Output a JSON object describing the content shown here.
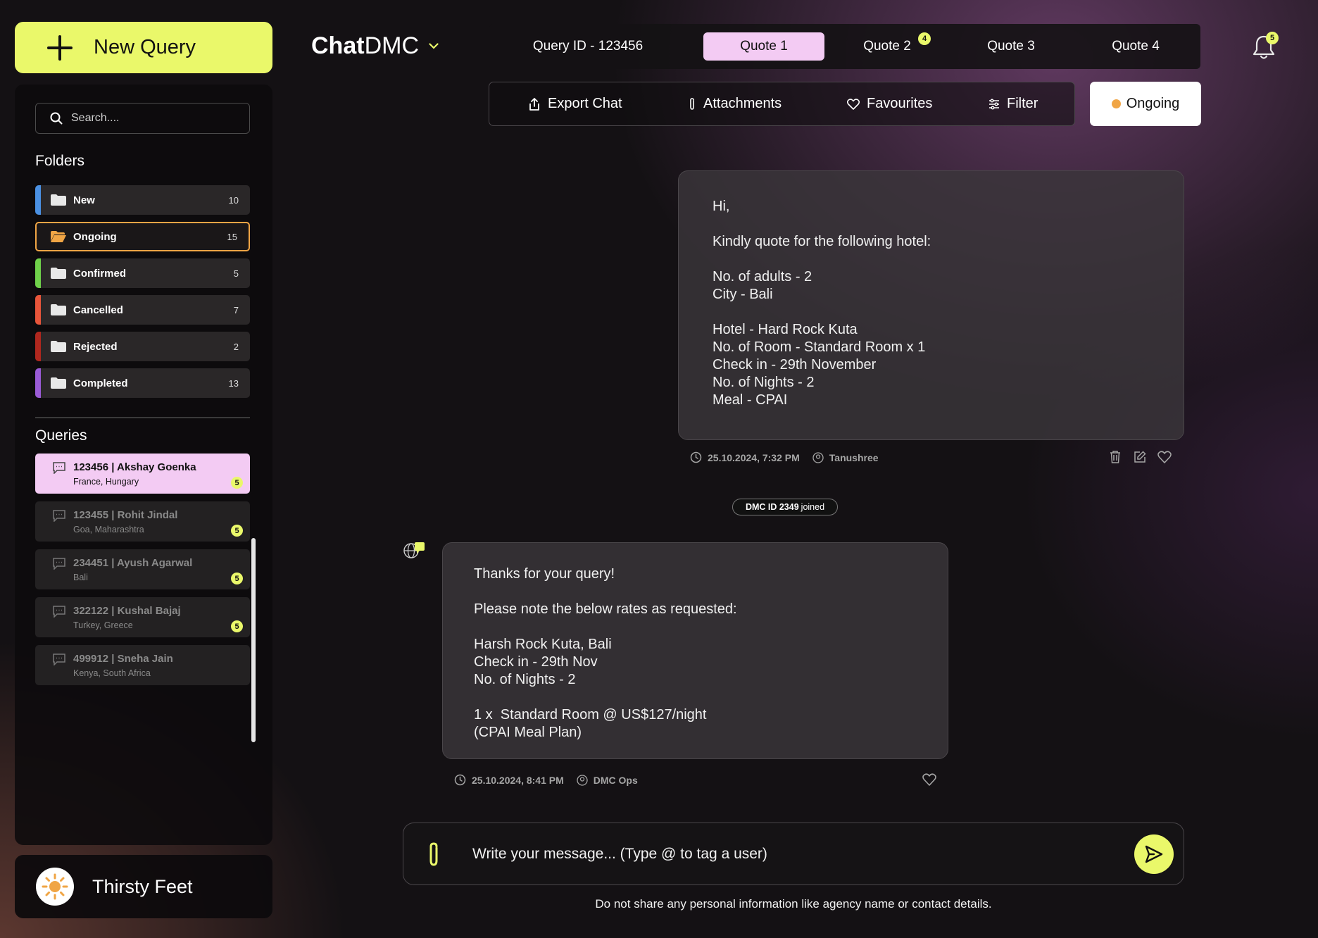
{
  "new_query": {
    "label": "New Query"
  },
  "sidebar": {
    "search_placeholder": "Search....",
    "folders_title": "Folders",
    "folders": [
      {
        "label": "New",
        "count": "10",
        "color": "#4a90e2"
      },
      {
        "label": "Ongoing",
        "count": "15",
        "color": "#f0a545"
      },
      {
        "label": "Confirmed",
        "count": "5",
        "color": "#6fd14a"
      },
      {
        "label": "Cancelled",
        "count": "7",
        "color": "#e8553a"
      },
      {
        "label": "Rejected",
        "count": "2",
        "color": "#b0271e"
      },
      {
        "label": "Completed",
        "count": "13",
        "color": "#9a5bd6"
      }
    ],
    "queries_title": "Queries",
    "queries": [
      {
        "title": "123456 | Akshay Goenka",
        "sub": "France, Hungary",
        "badge": "5"
      },
      {
        "title": "123455 | Rohit Jindal",
        "sub": "Goa, Maharashtra",
        "badge": "5"
      },
      {
        "title": "234451 | Ayush Agarwal",
        "sub": "Bali",
        "badge": "5"
      },
      {
        "title": "322122 | Kushal Bajaj",
        "sub": "Turkey, Greece",
        "badge": "5"
      },
      {
        "title": "499912 | Sneha Jain",
        "sub": "Kenya, South Africa",
        "badge": ""
      }
    ]
  },
  "profile": {
    "name": "Thirsty Feet"
  },
  "logo": {
    "bold": "Chat",
    "regular": "DMC"
  },
  "tabs": {
    "query_id": "Query ID - 123456",
    "items": [
      {
        "label": "Quote 1"
      },
      {
        "label": "Quote 2",
        "badge": "4"
      },
      {
        "label": "Quote 3"
      },
      {
        "label": "Quote 4"
      }
    ]
  },
  "notifications": {
    "badge": "5"
  },
  "toolbar": {
    "export": "Export Chat",
    "attachments": "Attachments",
    "favourites": "Favourites",
    "filter": "Filter",
    "status": "Ongoing"
  },
  "messages": [
    {
      "lines": [
        "Hi,",
        "",
        "Kindly quote for the following hotel:",
        "",
        "No. of adults - 2",
        "City - Bali",
        "",
        "Hotel - Hard Rock Kuta",
        "No. of Room - Standard Room x 1",
        "Check in - 29th November",
        "No. of Nights - 2",
        "Meal - CPAI"
      ],
      "time": "25.10.2024, 7:32 PM",
      "author": "Tanushree"
    },
    {
      "lines": [
        "Thanks for your query!",
        "",
        "Please note the below rates as requested:",
        "",
        "Harsh Rock Kuta, Bali",
        "Check in - 29th Nov",
        "No. of Nights - 2",
        "",
        "1 x  Standard Room @ US$127/night",
        "(CPAI Meal Plan)"
      ],
      "time": "25.10.2024, 8:41 PM",
      "author": "DMC Ops"
    }
  ],
  "joined": {
    "id": "DMC ID 2349",
    "suffix": "joined"
  },
  "composer": {
    "placeholder": "Write your message... (Type @ to tag a user)",
    "disclaimer": "Do not share any personal information like agency name or contact details."
  },
  "colors": {
    "accent": "#eaf86a",
    "pink": "#f3cbf3",
    "ongoing": "#f0a545"
  }
}
